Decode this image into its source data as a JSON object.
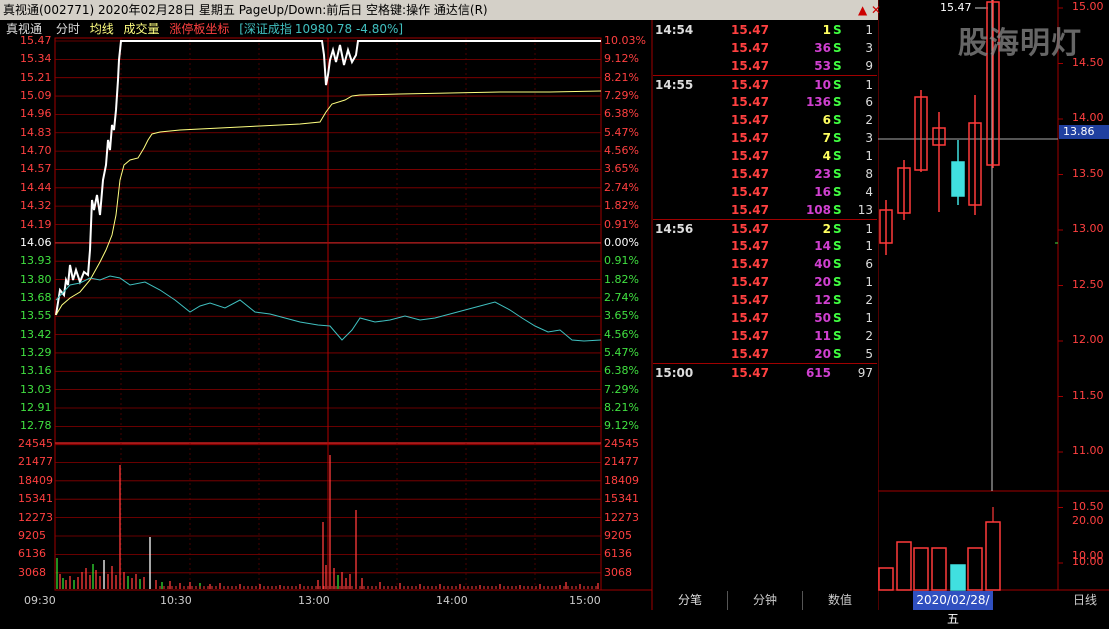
{
  "titlebar": {
    "text": "真视通(002771)  2020年02月28日  星期五  PageUp/Down:前后日  空格键:操作  通达信(R)",
    "buttons": "▲ ✕"
  },
  "header": {
    "name": "真视通",
    "tab_fenshi": "分时",
    "tab_junxian": "均线",
    "tab_volume": "成交量",
    "tab_limit": "涨停板坐标",
    "index_label": "[深证成指",
    "index_value": "10980.78 -4.80%]"
  },
  "colors": {
    "up": "#ff3a3a",
    "down": "#33dd33",
    "grid": "#a00000",
    "price": "#ffffff",
    "avg": "#ffff80",
    "index": "#40c0c0"
  },
  "price_axis": {
    "left": [
      "15.47",
      "15.34",
      "15.21",
      "15.09",
      "14.96",
      "14.83",
      "14.70",
      "14.57",
      "14.44",
      "14.32",
      "14.19",
      "14.06",
      "13.93",
      "13.80",
      "13.68",
      "13.55",
      "13.42",
      "13.29",
      "13.16",
      "13.03",
      "12.91",
      "12.78"
    ],
    "right": [
      "10.03%",
      "9.12%",
      "8.21%",
      "7.29%",
      "6.38%",
      "5.47%",
      "4.56%",
      "3.65%",
      "2.74%",
      "1.82%",
      "0.91%",
      "0.00%",
      "0.91%",
      "1.82%",
      "2.74%",
      "3.65%",
      "4.56%",
      "5.47%",
      "6.38%",
      "7.29%",
      "8.21%",
      "9.12%"
    ]
  },
  "volume_axis": [
    "24545",
    "21477",
    "18409",
    "15341",
    "12273",
    "9205",
    "6136",
    "3068"
  ],
  "time_axis": [
    "09:30",
    "10:30",
    "13:00",
    "14:00",
    "15:00"
  ],
  "trades": [
    {
      "time": "14:54",
      "price": "15.47",
      "vol": "1",
      "side": "S",
      "num": "1",
      "vc": "#ffff60"
    },
    {
      "time": "",
      "price": "15.47",
      "vol": "36",
      "side": "S",
      "num": "3",
      "vc": "#d040d0"
    },
    {
      "time": "",
      "price": "15.47",
      "vol": "53",
      "side": "S",
      "num": "9",
      "vc": "#d040d0"
    },
    {
      "time": "14:55",
      "price": "15.47",
      "vol": "10",
      "side": "S",
      "num": "1",
      "vc": "#d040d0"
    },
    {
      "time": "",
      "price": "15.47",
      "vol": "136",
      "side": "S",
      "num": "6",
      "vc": "#d040d0"
    },
    {
      "time": "",
      "price": "15.47",
      "vol": "6",
      "side": "S",
      "num": "2",
      "vc": "#ffff60"
    },
    {
      "time": "",
      "price": "15.47",
      "vol": "7",
      "side": "S",
      "num": "3",
      "vc": "#ffff60"
    },
    {
      "time": "",
      "price": "15.47",
      "vol": "4",
      "side": "S",
      "num": "1",
      "vc": "#ffff60"
    },
    {
      "time": "",
      "price": "15.47",
      "vol": "23",
      "side": "S",
      "num": "8",
      "vc": "#d040d0"
    },
    {
      "time": "",
      "price": "15.47",
      "vol": "16",
      "side": "S",
      "num": "4",
      "vc": "#d040d0"
    },
    {
      "time": "",
      "price": "15.47",
      "vol": "108",
      "side": "S",
      "num": "13",
      "vc": "#d040d0"
    },
    {
      "time": "14:56",
      "price": "15.47",
      "vol": "2",
      "side": "S",
      "num": "1",
      "vc": "#ffff60"
    },
    {
      "time": "",
      "price": "15.47",
      "vol": "14",
      "side": "S",
      "num": "1",
      "vc": "#d040d0"
    },
    {
      "time": "",
      "price": "15.47",
      "vol": "40",
      "side": "S",
      "num": "6",
      "vc": "#d040d0"
    },
    {
      "time": "",
      "price": "15.47",
      "vol": "20",
      "side": "S",
      "num": "1",
      "vc": "#d040d0"
    },
    {
      "time": "",
      "price": "15.47",
      "vol": "12",
      "side": "S",
      "num": "2",
      "vc": "#d040d0"
    },
    {
      "time": "",
      "price": "15.47",
      "vol": "50",
      "side": "S",
      "num": "1",
      "vc": "#d040d0"
    },
    {
      "time": "",
      "price": "15.47",
      "vol": "11",
      "side": "S",
      "num": "2",
      "vc": "#d040d0"
    },
    {
      "time": "",
      "price": "15.47",
      "vol": "20",
      "side": "S",
      "num": "5",
      "vc": "#d040d0"
    },
    {
      "time": "15:00",
      "price": "15.47",
      "vol": "615",
      "side": "",
      "num": "97",
      "vc": "#d040d0"
    }
  ],
  "bottom_tabs": {
    "tab1": "分笔",
    "tab2": "分钟",
    "tab3": "数值",
    "date": "2020/02/28/五",
    "period": "日线"
  },
  "kline": {
    "price_labels": [
      "15.00",
      "14.50",
      "14.00",
      "13.50",
      "13.00",
      "12.50",
      "12.00",
      "11.50",
      "11.00",
      "10.50",
      "10.00"
    ],
    "vol_labels": [
      "20.00",
      "10.00"
    ],
    "current": "13.86",
    "peak_label": "15.47",
    "watermark": "股海明灯"
  }
}
